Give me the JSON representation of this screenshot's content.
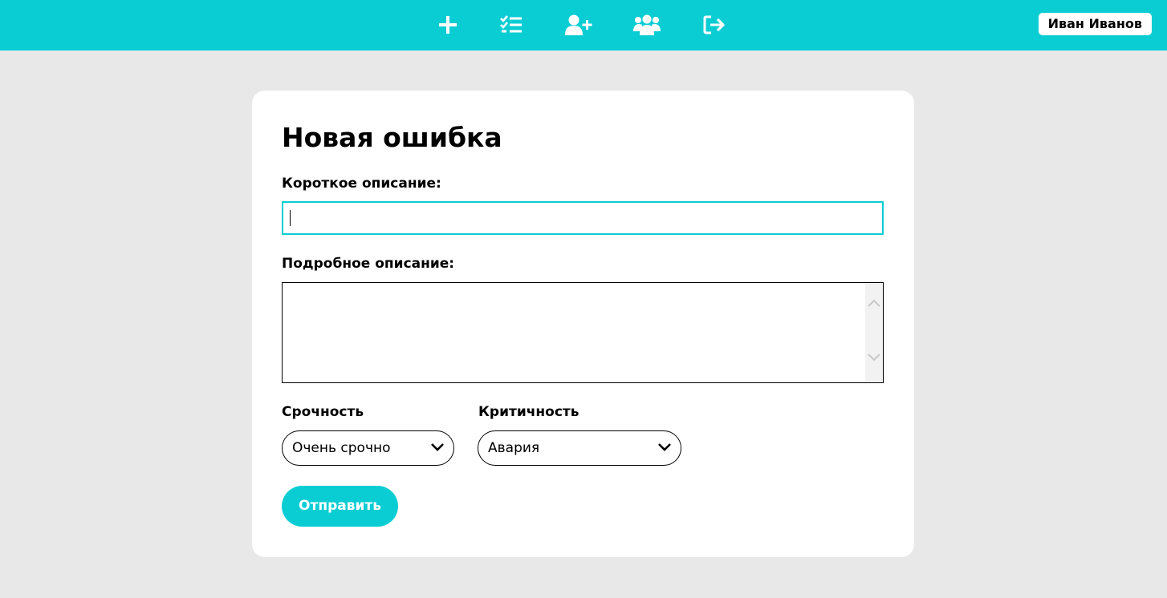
{
  "header": {
    "nav_icons": [
      "plus-icon",
      "checklist-icon",
      "user-plus-icon",
      "users-icon",
      "sign-out-icon"
    ],
    "user_name": "Иван Иванов",
    "accent_color": "#0acdd4"
  },
  "form": {
    "title": "Новая ошибка",
    "short_description": {
      "label": "Короткое описание:",
      "value": ""
    },
    "detailed_description": {
      "label": "Подробное описание:",
      "value": ""
    },
    "urgency": {
      "label": "Срочность",
      "selected": "Очень срочно"
    },
    "criticality": {
      "label": "Критичность",
      "selected": "Авария"
    },
    "submit_label": "Отправить"
  }
}
